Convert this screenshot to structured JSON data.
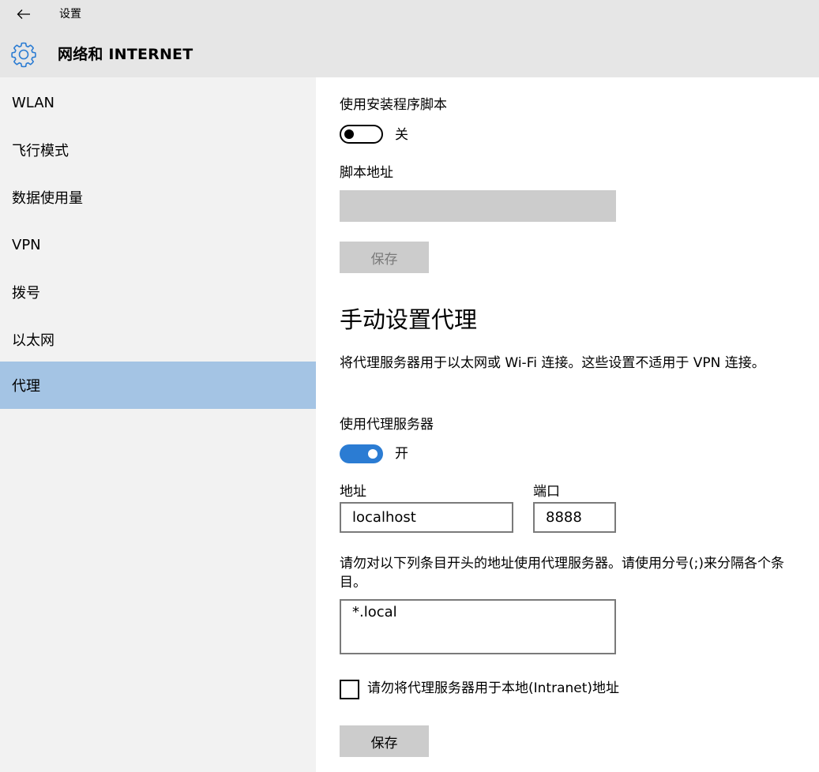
{
  "app": {
    "title": "设置",
    "section_title": "网络和 INTERNET"
  },
  "icons": {
    "back": "back-arrow-icon",
    "settings": "gear-icon"
  },
  "colors": {
    "header_bg": "#e6e6e6",
    "sidebar_bg": "#f2f2f2",
    "selected_bg": "#a4c4e4",
    "accent": "#2b7cd3"
  },
  "sidebar": {
    "items": [
      {
        "label": "WLAN"
      },
      {
        "label": "飞行模式"
      },
      {
        "label": "数据使用量"
      },
      {
        "label": "VPN"
      },
      {
        "label": "拨号"
      },
      {
        "label": "以太网"
      },
      {
        "label": "代理",
        "selected": true
      }
    ]
  },
  "auto_script": {
    "label": "使用安装程序脚本",
    "toggle_state": "关",
    "toggle_on": false,
    "address_label": "脚本地址",
    "address_value": "",
    "save_label": "保存"
  },
  "manual_proxy": {
    "heading": "手动设置代理",
    "description": "将代理服务器用于以太网或 Wi-Fi 连接。这些设置不适用于 VPN 连接。",
    "use_proxy_label": "使用代理服务器",
    "toggle_state": "开",
    "toggle_on": true,
    "address_label": "地址",
    "address_value": "localhost",
    "port_label": "端口",
    "port_value": "8888",
    "exceptions_description": "请勿对以下列条目开头的地址使用代理服务器。请使用分号(;)来分隔各个条目。",
    "exceptions_value": "*.local",
    "bypass_local_label": "请勿将代理服务器用于本地(Intranet)地址",
    "bypass_local_checked": false,
    "save_label": "保存"
  }
}
